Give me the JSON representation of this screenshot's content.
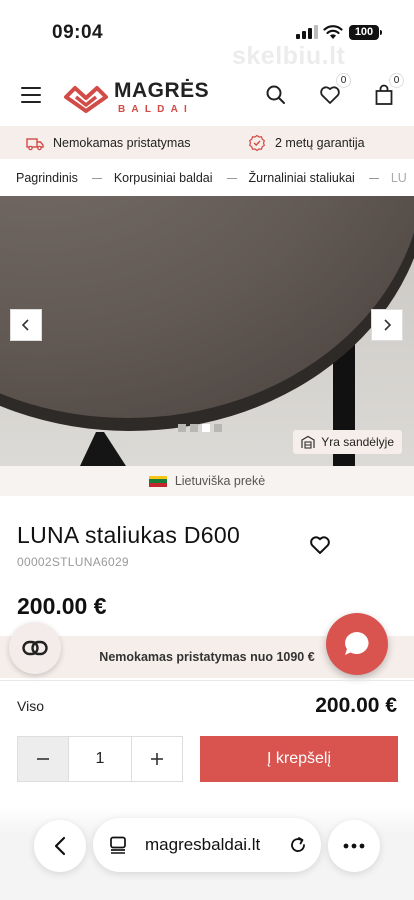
{
  "status_bar": {
    "time": "09:04",
    "battery": "100"
  },
  "watermark": "skelbiu.lt",
  "header": {
    "logo_name": "MAGRĖS",
    "logo_sub": "BALDAI",
    "wishlist_count": "0",
    "cart_count": "0"
  },
  "info_bar": {
    "delivery": "Nemokamas pristatymas",
    "warranty": "2 metų garantija"
  },
  "breadcrumb": [
    "Pagrindinis",
    "Korpusiniai baldai",
    "Žurnaliniai staliukai",
    "LU"
  ],
  "gallery": {
    "slide_count": 4,
    "active_slide": 3,
    "stock_label": "Yra sandėlyje"
  },
  "origin_label": "Lietuviška prekė",
  "product": {
    "title": "LUNA staliukas D600",
    "sku": "00002STLUNA6029",
    "price": "200.00 €"
  },
  "free_shipping": "Nemokamas pristatymas nuo 1090 €",
  "totals": {
    "label": "Viso",
    "value": "200.00 €"
  },
  "quantity": "1",
  "cart_button": "Į krepšelį",
  "browser": {
    "url": "magresbaldai.lt"
  },
  "colors": {
    "accent": "#d9534f",
    "cream": "#f6eeea"
  }
}
